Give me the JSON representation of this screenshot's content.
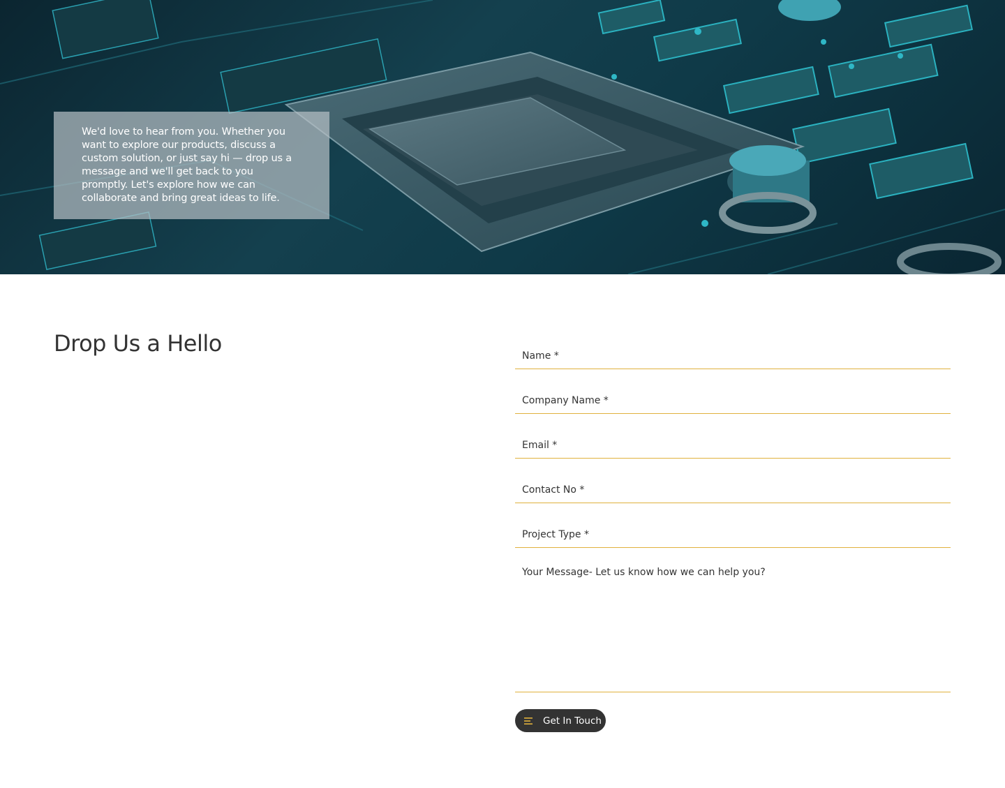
{
  "hero": {
    "intro": "We'd love to hear from you. Whether you want to explore our products, discuss a custom solution, or just say hi — drop us a message and we'll get back to you promptly. Let's explore how we can collaborate and bring great ideas to life."
  },
  "contact": {
    "heading": "Drop Us a Hello",
    "fields": {
      "name": "Name *",
      "company": "Company Name *",
      "email": "Email *",
      "contact": "Contact No *",
      "project": "Project Type *",
      "message": "Your Message- Let us know how we can help you?"
    },
    "submit_label": "Get In Touch",
    "submit_icon": "menu-lines-icon"
  },
  "colors": {
    "accent": "#e0b13d",
    "button_bg": "#333333",
    "text": "#333333"
  }
}
